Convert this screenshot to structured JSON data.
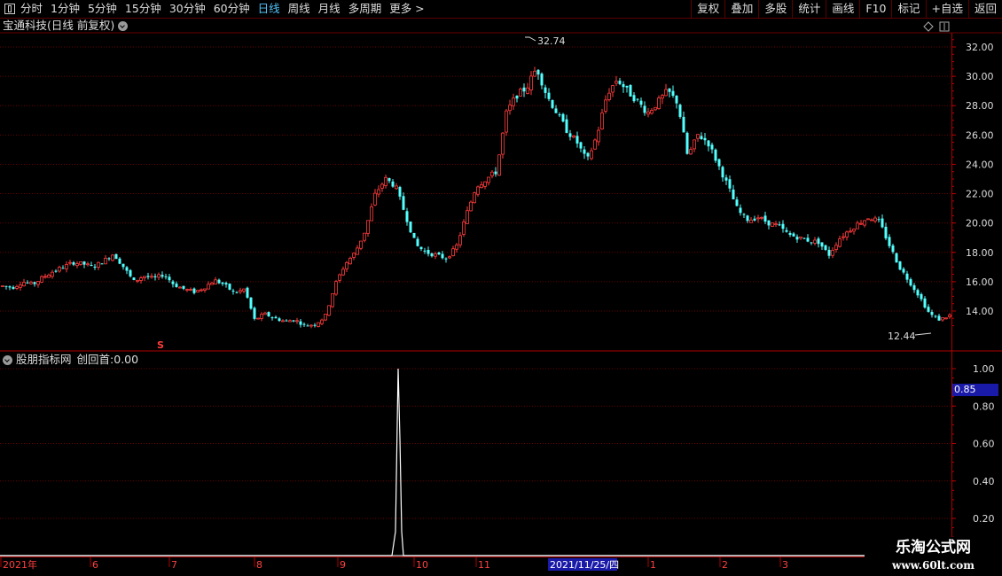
{
  "toolbar": {
    "items": [
      "分时",
      "1分钟",
      "5分钟",
      "15分钟",
      "30分钟",
      "60分钟",
      "日线",
      "周线",
      "月线",
      "多周期",
      "更多 >"
    ],
    "active": "日线",
    "right_buttons": [
      "复权",
      "叠加",
      "多股",
      "统计",
      "画线",
      "F10",
      "标记",
      "+自选",
      "返回"
    ]
  },
  "chart_title": "宝通科技(日线 前复权)",
  "price_axis": {
    "labels": [
      "32.00",
      "30.00",
      "28.00",
      "26.00",
      "24.00",
      "22.00",
      "20.00",
      "18.00",
      "16.00",
      "14.00"
    ],
    "max_label": "32.74",
    "min_label": "12.44"
  },
  "indicator": {
    "title": "股朋指标网",
    "name": "创回首",
    "value": "0.00",
    "current_tag": "0.85",
    "axis_labels": [
      "1.00",
      "0.80",
      "0.60",
      "0.40",
      "0.20"
    ]
  },
  "time_axis": {
    "labels": [
      "2021年",
      "6",
      "7",
      "8",
      "9",
      "10",
      "11",
      "1",
      "2",
      "3"
    ],
    "cursor_date": "2021/11/25/四"
  },
  "marker_text": "S",
  "watermark": {
    "title": "乐淘公式网",
    "url": "www.60lt.com"
  },
  "colors": {
    "up": "#ff3b3b",
    "down": "#54ffff",
    "grid": "#6a0000",
    "axis": "#b00000",
    "active": "#4fc3f7"
  },
  "chart_data": {
    "type": "candlestick",
    "ylim": [
      12.0,
      33.0
    ],
    "price_series_approx": [
      15.7,
      15.6,
      16.0,
      15.8,
      16.3,
      16.7,
      17.0,
      17.3,
      17.2,
      17.0,
      17.4,
      17.9,
      17.0,
      16.0,
      16.4,
      16.2,
      16.5,
      15.8,
      15.5,
      15.3,
      15.6,
      16.1,
      15.8,
      15.2,
      15.5,
      13.4,
      13.8,
      13.5,
      13.3,
      13.4,
      13.0,
      13.1,
      13.6,
      15.8,
      17.2,
      18.0,
      19.5,
      22.0,
      23.0,
      22.5,
      20.5,
      18.5,
      18.0,
      17.8,
      17.6,
      18.3,
      20.5,
      22.5,
      23.0,
      23.5,
      27.5,
      28.7,
      29.2,
      30.6,
      28.7,
      27.5,
      26.3,
      25.5,
      24.2,
      26.0,
      28.8,
      29.8,
      29.0,
      28.3,
      27.5,
      28.2,
      29.0,
      28.2,
      24.5,
      26.0,
      25.5,
      24.0,
      22.5,
      20.8,
      20.2,
      20.4,
      20.0,
      19.8,
      19.2,
      19.0,
      18.8,
      18.7,
      17.8,
      18.9,
      19.5,
      20.0,
      20.4,
      20.1,
      18.5,
      17.0,
      16.0,
      15.0,
      13.8,
      13.4,
      13.7
    ],
    "indicator_spike": {
      "time": "2021-09 late",
      "value": 1.0
    }
  }
}
